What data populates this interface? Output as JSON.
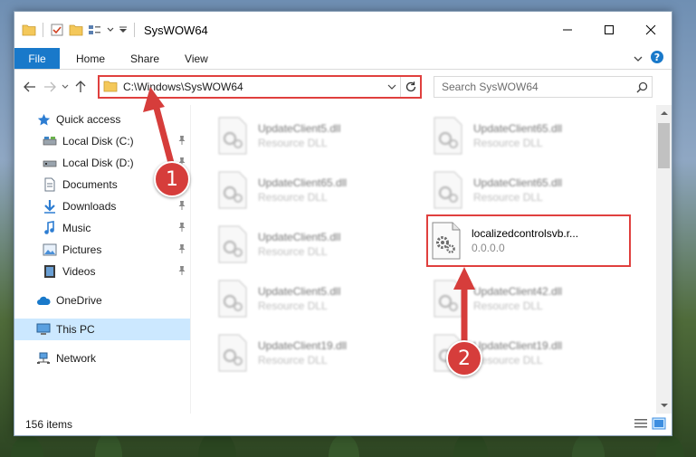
{
  "window": {
    "title": "SysWOW64"
  },
  "ribbon": {
    "tabs": [
      "File",
      "Home",
      "Share",
      "View"
    ]
  },
  "address": {
    "path": "C:\\Windows\\SysWOW64"
  },
  "search": {
    "placeholder": "Search SysWOW64"
  },
  "sidebar": {
    "items": [
      {
        "label": "Quick access",
        "icon": "star-icon"
      },
      {
        "label": "Local Disk (C:)",
        "icon": "drive-icon"
      },
      {
        "label": "Local Disk (D:)",
        "icon": "drive-icon"
      },
      {
        "label": "Documents",
        "icon": "documents-icon"
      },
      {
        "label": "Downloads",
        "icon": "download-icon"
      },
      {
        "label": "Music",
        "icon": "music-icon"
      },
      {
        "label": "Pictures",
        "icon": "pictures-icon"
      },
      {
        "label": "Videos",
        "icon": "videos-icon"
      },
      {
        "label": "OneDrive",
        "icon": "cloud-icon"
      },
      {
        "label": "This PC",
        "icon": "computer-icon"
      },
      {
        "label": "Network",
        "icon": "network-icon"
      }
    ]
  },
  "files": [
    {
      "name": "UpdateClient5.dll",
      "type": "Resource DLL"
    },
    {
      "name": "UpdateClient65.dll",
      "type": "Resource DLL"
    },
    {
      "name": "UpdateClient65.dll",
      "type": "Resource DLL"
    },
    {
      "name": "UpdateClient65.dll",
      "type": "Resource DLL"
    },
    {
      "name": "UpdateClient5.dll",
      "type": "Resource DLL"
    },
    {
      "name": "localizedcontrolsvb.r...",
      "type": "0.0.0.0"
    },
    {
      "name": "UpdateClient5.dll",
      "type": "Resource DLL"
    },
    {
      "name": "UpdateClient42.dll",
      "type": "Resource DLL"
    },
    {
      "name": "UpdateClient19.dll",
      "type": "Resource DLL"
    },
    {
      "name": "UpdateClient19.dll",
      "type": "Resource DLL"
    }
  ],
  "status": {
    "item_count": "156 items"
  },
  "annotations": {
    "step1": "1",
    "step2": "2",
    "color": "#d63d3b"
  },
  "colors": {
    "file_tab": "#1979ca",
    "highlight_border": "#e0403e",
    "selected_nav": "#cce8ff"
  }
}
